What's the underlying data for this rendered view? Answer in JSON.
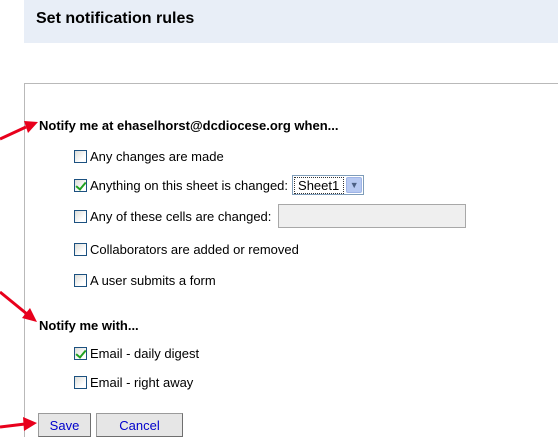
{
  "title": "Set notification rules",
  "notify_at": {
    "heading": "Notify me at ehaselhorst@dcdiocese.org when...",
    "options": [
      {
        "label": "Any changes are made",
        "checked": false
      },
      {
        "label": "Anything on this sheet is changed:",
        "checked": true,
        "select_value": "Sheet1"
      },
      {
        "label": "Any of these cells are changed:",
        "checked": false,
        "input_value": ""
      },
      {
        "label": "Collaborators are added or removed",
        "checked": false
      },
      {
        "label": "A user submits a form",
        "checked": false
      }
    ]
  },
  "notify_with": {
    "heading": "Notify me with...",
    "options": [
      {
        "label": "Email - daily digest",
        "checked": true
      },
      {
        "label": "Email - right away",
        "checked": false
      }
    ]
  },
  "buttons": {
    "save": "Save",
    "cancel": "Cancel"
  },
  "colors": {
    "title_bar": "#e8eef7",
    "arrow": "#e8001c",
    "link_text": "#0000cc",
    "check": "#21a121"
  }
}
